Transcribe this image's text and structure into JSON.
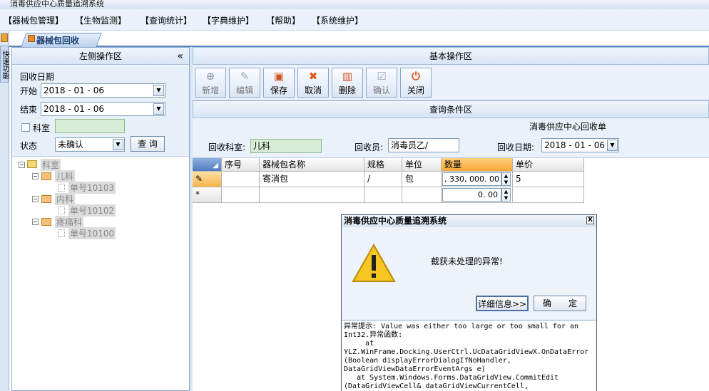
{
  "window": {
    "title": "消毒供应中心质量追溯系统"
  },
  "menu": [
    "【器械包管理】",
    "【生物监测】",
    "【查询统计】",
    "【字典维护】",
    "【帮助】",
    "【系统维护】"
  ],
  "side_tab": "快速功能",
  "doc_tab": "器械包回收",
  "left_panel": {
    "title": "左侧操作区",
    "collapse": "«",
    "date_label": "回收日期",
    "start_label": "开始",
    "start_value": "2018 - 01 - 06",
    "end_label": "结束",
    "end_value": "2018 - 01 - 06",
    "dept_label": "科室",
    "status_label": "状态",
    "status_value": "未确认",
    "query_button": "查 询",
    "tree": {
      "root": "科室",
      "depts": [
        {
          "name": "儿科",
          "order": "单号10103"
        },
        {
          "name": "内科",
          "order": "单号10102"
        },
        {
          "name": "疼痛科",
          "order": "单号10100"
        }
      ]
    }
  },
  "basic_ops": {
    "title": "基本操作区",
    "buttons": [
      {
        "label": "新增",
        "icon": "add-icon"
      },
      {
        "label": "编辑",
        "icon": "edit-icon"
      },
      {
        "label": "保存",
        "icon": "save-icon"
      },
      {
        "label": "取消",
        "icon": "cancel-icon"
      },
      {
        "label": "删除",
        "icon": "delete-icon"
      },
      {
        "label": "确认",
        "icon": "confirm-icon"
      },
      {
        "label": "关闭",
        "icon": "power-icon"
      }
    ]
  },
  "query": {
    "title": "查询条件区",
    "form_title": "消毒供应中心回收单",
    "dept_label": "回收科室:",
    "dept_value": "儿科",
    "person_label": "回收员:",
    "person_value": "消毒员乙/",
    "date_label": "回收日期:",
    "date_value": "2018 - 01 - 06"
  },
  "grid": {
    "columns": [
      "序号",
      "器械包名称",
      "规格",
      "单位",
      "数量",
      "单价"
    ],
    "rows": [
      {
        "marker": "✎",
        "seq": "",
        "name": "寄消包",
        "spec": "/",
        "unit": "包",
        "qty": ", 330, 000. 00",
        "price": "5"
      },
      {
        "marker": "*",
        "seq": "",
        "name": "",
        "spec": "",
        "unit": "",
        "qty": "0. 00",
        "price": ""
      }
    ]
  },
  "dialog": {
    "title": "消毒供应中心质量追溯系统",
    "close": "X",
    "message": "截获未处理的异常!",
    "details_button": "详细信息>>",
    "ok_button": "确　　定",
    "details": "异常提示: Value was either too large or too small for an Int32.异常函数:\n     at\nYLZ.WinFrame.Docking.UserCtrl.UcDataGridViewX.OnDataError\n(Boolean displayErrorDialogIfNoHandler,\nDataGridViewDataErrorEventArgs e)\n   at System.Windows.Forms.DataGridView.CommitEdit\n(DataGridViewCell& dataGridViewCurrentCell,"
  }
}
